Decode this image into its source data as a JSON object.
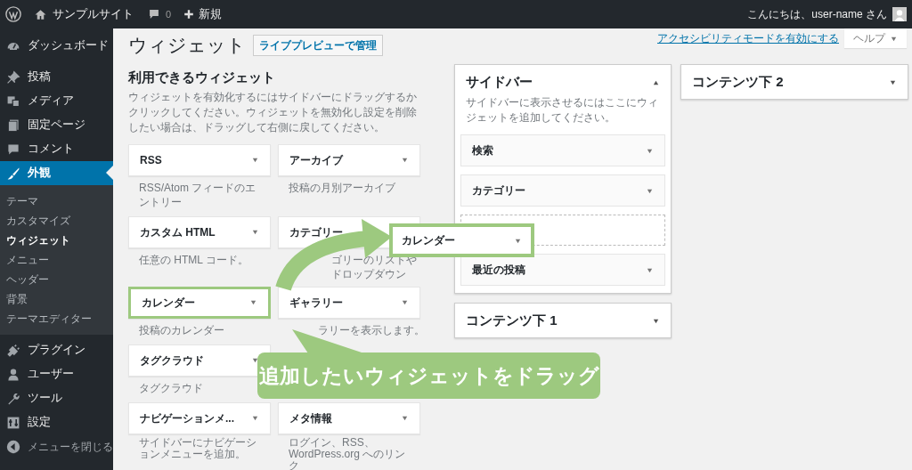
{
  "admin_bar": {
    "site_name": "サンプルサイト",
    "comments": "0",
    "new": "新規",
    "greeting": "こんにちは、user-name さん"
  },
  "menu": [
    {
      "label": "ダッシュボード",
      "selected": false
    },
    {
      "label": "投稿",
      "selected": false
    },
    {
      "label": "メディア",
      "selected": false
    },
    {
      "label": "固定ページ",
      "selected": false
    },
    {
      "label": "コメント",
      "selected": false
    },
    {
      "label": "外観",
      "selected": true,
      "children": [
        {
          "label": "テーマ",
          "selected": false
        },
        {
          "label": "カスタマイズ",
          "selected": false
        },
        {
          "label": "ウィジェット",
          "selected": true
        },
        {
          "label": "メニュー",
          "selected": false
        },
        {
          "label": "ヘッダー",
          "selected": false
        },
        {
          "label": "背景",
          "selected": false
        },
        {
          "label": "テーマエディター",
          "selected": false
        }
      ]
    },
    {
      "label": "プラグイン",
      "selected": false
    },
    {
      "label": "ユーザー",
      "selected": false
    },
    {
      "label": "ツール",
      "selected": false
    },
    {
      "label": "設定",
      "selected": false
    }
  ],
  "collapse_menu": "メニューを閉じる",
  "screen_links": {
    "accessibility": "アクセシビリティモードを有効にする",
    "help": "ヘルプ"
  },
  "page": {
    "title": "ウィジェット",
    "action": "ライブプレビューで管理"
  },
  "available": {
    "heading": "利用できるウィジェット",
    "description": "ウィジェットを有効化するにはサイドバーにドラッグするかクリックしてください。ウィジェットを無効化し設定を削除したい場合は、ドラッグして右側に戻してください。",
    "widgets": [
      {
        "title": "RSS",
        "description": "RSS/Atom フィードのエントリー",
        "dragging": false
      },
      {
        "title": "アーカイブ",
        "description": "投稿の月別アーカイブ",
        "dragging": false
      },
      {
        "title": "カスタム HTML",
        "description": "任意の HTML コード。",
        "dragging": false
      },
      {
        "title": "カテゴリー",
        "description": "ゴリーのリストやドロップダウン",
        "dragging": false,
        "caret_visible": false
      },
      {
        "title": "カレンダー",
        "description": "投稿のカレンダー",
        "dragging": true
      },
      {
        "title": "ギャラリー",
        "description": "ラリーを表示します。",
        "dragging": false
      },
      {
        "title": "タグクラウド",
        "description": "タグクラウド",
        "dragging": false
      },
      {
        "kind": "covered"
      },
      {
        "title": "ナビゲーションメ...",
        "description": "サイドバーにナビゲーションメニューを追加。",
        "dragging": false
      },
      {
        "title": "メタ情報",
        "description": "ログイン、RSS、WordPress.org へのリンク",
        "dragging": false
      }
    ]
  },
  "areas": [
    {
      "title": "サイドバー",
      "expanded": true,
      "description": "サイドバーに表示させるにはここにウィジェットを追加してください。",
      "widgets": [
        {
          "title": "検索",
          "kind": "widget"
        },
        {
          "title": "カテゴリー",
          "kind": "widget"
        },
        {
          "kind": "drop_target"
        },
        {
          "title": "最近の投稿",
          "kind": "widget"
        }
      ]
    },
    {
      "title": "コンテンツ下 1",
      "expanded": false
    },
    {
      "title": "コンテンツ下 2",
      "expanded": false
    }
  ],
  "overlay": {
    "dragged_widget": "カレンダー",
    "callout": "追加したいウィジェットをドラッグ"
  }
}
